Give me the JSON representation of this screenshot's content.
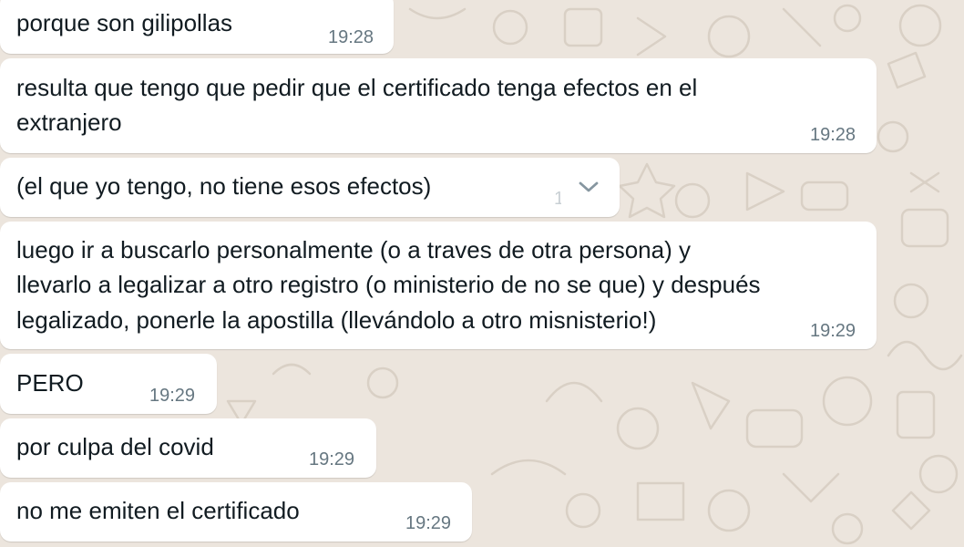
{
  "colors": {
    "wallpaper": "#ECE5DD",
    "bubble": "#FFFFFF",
    "text": "#111B21",
    "timestamp": "#667781"
  },
  "messages": [
    {
      "lines": [
        "porque son gilipollas"
      ],
      "time": "19:28"
    },
    {
      "lines": [
        "resulta que tengo que pedir que el certificado tenga efectos en el",
        "extranjero"
      ],
      "time": "19:28"
    },
    {
      "lines": [
        "(el que yo tengo, no tiene esos efectos)"
      ],
      "time": "1",
      "menu_icon": "chevron-down-icon"
    },
    {
      "lines": [
        "luego ir a buscarlo personalmente (o a traves de otra persona) y",
        "llevarlo a legalizar a otro registro (o ministerio de no se que) y después",
        "legalizado, ponerle la apostilla (llevándolo a otro misnisterio!)"
      ],
      "time": "19:29"
    },
    {
      "lines": [
        "PERO"
      ],
      "time": "19:29"
    },
    {
      "lines": [
        "por culpa del covid"
      ],
      "time": "19:29"
    },
    {
      "lines": [
        "no me emiten el certificado"
      ],
      "time": "19:29"
    }
  ]
}
